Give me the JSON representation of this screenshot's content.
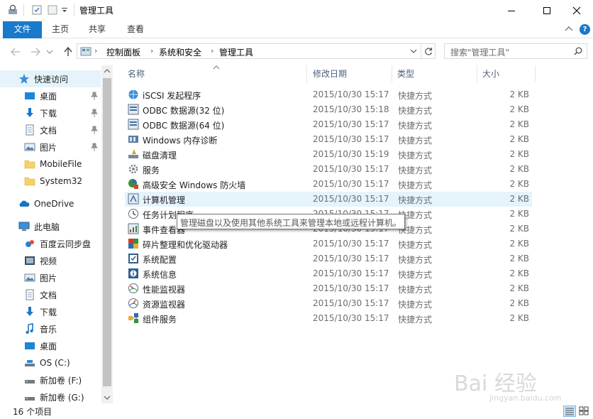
{
  "window": {
    "title": "管理工具"
  },
  "ribbon": {
    "tabs": [
      "文件",
      "主页",
      "共享",
      "查看"
    ]
  },
  "address": {
    "crumbs": [
      "控制面板",
      "系统和安全",
      "管理工具"
    ]
  },
  "search": {
    "placeholder": "搜索\"管理工具\""
  },
  "nav": {
    "quick_access": "快速访问",
    "items": [
      {
        "label": "桌面",
        "icon": "desktop-icon",
        "pinned": true
      },
      {
        "label": "下载",
        "icon": "download-icon",
        "pinned": true
      },
      {
        "label": "文档",
        "icon": "documents-icon",
        "pinned": true
      },
      {
        "label": "图片",
        "icon": "pictures-icon",
        "pinned": true
      },
      {
        "label": "MobileFile",
        "icon": "folder-icon",
        "pinned": false
      },
      {
        "label": "System32",
        "icon": "folder-icon",
        "pinned": false
      }
    ],
    "onedrive": "OneDrive",
    "this_pc": "此电脑",
    "pc_items": [
      {
        "label": "百度云同步盘",
        "icon": "cloud-sync-icon"
      },
      {
        "label": "视频",
        "icon": "video-icon"
      },
      {
        "label": "图片",
        "icon": "pictures-icon"
      },
      {
        "label": "文档",
        "icon": "documents-icon"
      },
      {
        "label": "下载",
        "icon": "download-icon"
      },
      {
        "label": "音乐",
        "icon": "music-icon"
      },
      {
        "label": "桌面",
        "icon": "desktop-icon"
      },
      {
        "label": "OS (C:)",
        "icon": "drive-icon"
      },
      {
        "label": "新加卷 (F:)",
        "icon": "drive-icon"
      },
      {
        "label": "新加卷 (G:)",
        "icon": "drive-icon"
      }
    ]
  },
  "columns": {
    "name": "名称",
    "date": "修改日期",
    "type": "类型",
    "size": "大小"
  },
  "files": [
    {
      "name": "iSCSI 发起程序",
      "date": "2015/10/30 15:17",
      "type": "快捷方式",
      "size": "2 KB",
      "icon": "iscsi-icon"
    },
    {
      "name": "ODBC 数据源(32 位)",
      "date": "2015/10/30 15:18",
      "type": "快捷方式",
      "size": "2 KB",
      "icon": "odbc-icon"
    },
    {
      "name": "ODBC 数据源(64 位)",
      "date": "2015/10/30 15:17",
      "type": "快捷方式",
      "size": "2 KB",
      "icon": "odbc-icon"
    },
    {
      "name": "Windows 内存诊断",
      "date": "2015/10/30 15:17",
      "type": "快捷方式",
      "size": "2 KB",
      "icon": "memory-diagnostic-icon"
    },
    {
      "name": "磁盘清理",
      "date": "2015/10/30 15:19",
      "type": "快捷方式",
      "size": "2 KB",
      "icon": "disk-cleanup-icon"
    },
    {
      "name": "服务",
      "date": "2015/10/30 15:17",
      "type": "快捷方式",
      "size": "2 KB",
      "icon": "services-icon"
    },
    {
      "name": "高级安全 Windows 防火墙",
      "date": "2015/10/30 15:17",
      "type": "快捷方式",
      "size": "2 KB",
      "icon": "firewall-icon"
    },
    {
      "name": "计算机管理",
      "date": "2015/10/30 15:17",
      "type": "快捷方式",
      "size": "2 KB",
      "icon": "computer-management-icon"
    },
    {
      "name": "任务计划程序",
      "date": "2015/10/30 15:17",
      "type": "快捷方式",
      "size": "2 KB",
      "icon": "task-scheduler-icon"
    },
    {
      "name": "事件查看器",
      "date": "2015/10/30 15:17",
      "type": "快捷方式",
      "size": "2 KB",
      "icon": "event-viewer-icon"
    },
    {
      "name": "碎片整理和优化驱动器",
      "date": "2015/10/30 15:17",
      "type": "快捷方式",
      "size": "2 KB",
      "icon": "defrag-icon"
    },
    {
      "name": "系统配置",
      "date": "2015/10/30 15:17",
      "type": "快捷方式",
      "size": "2 KB",
      "icon": "system-config-icon"
    },
    {
      "name": "系统信息",
      "date": "2015/10/30 15:17",
      "type": "快捷方式",
      "size": "2 KB",
      "icon": "system-info-icon"
    },
    {
      "name": "性能监视器",
      "date": "2015/10/30 15:17",
      "type": "快捷方式",
      "size": "2 KB",
      "icon": "performance-monitor-icon"
    },
    {
      "name": "资源监视器",
      "date": "2015/10/30 15:17",
      "type": "快捷方式",
      "size": "2 KB",
      "icon": "resource-monitor-icon"
    },
    {
      "name": "组件服务",
      "date": "2015/10/30 15:17",
      "type": "快捷方式",
      "size": "2 KB",
      "icon": "component-services-icon"
    }
  ],
  "tooltip": "管理磁盘以及使用其他系统工具来管理本地或远程计算机。",
  "status": {
    "item_count": "16 个项目"
  },
  "watermark": {
    "brand": "Bai 经验",
    "url": "jingyan.baidu.com"
  },
  "colors": {
    "accent": "#1979ca",
    "hover": "#e5f3fb",
    "header_text": "#4c607a"
  }
}
